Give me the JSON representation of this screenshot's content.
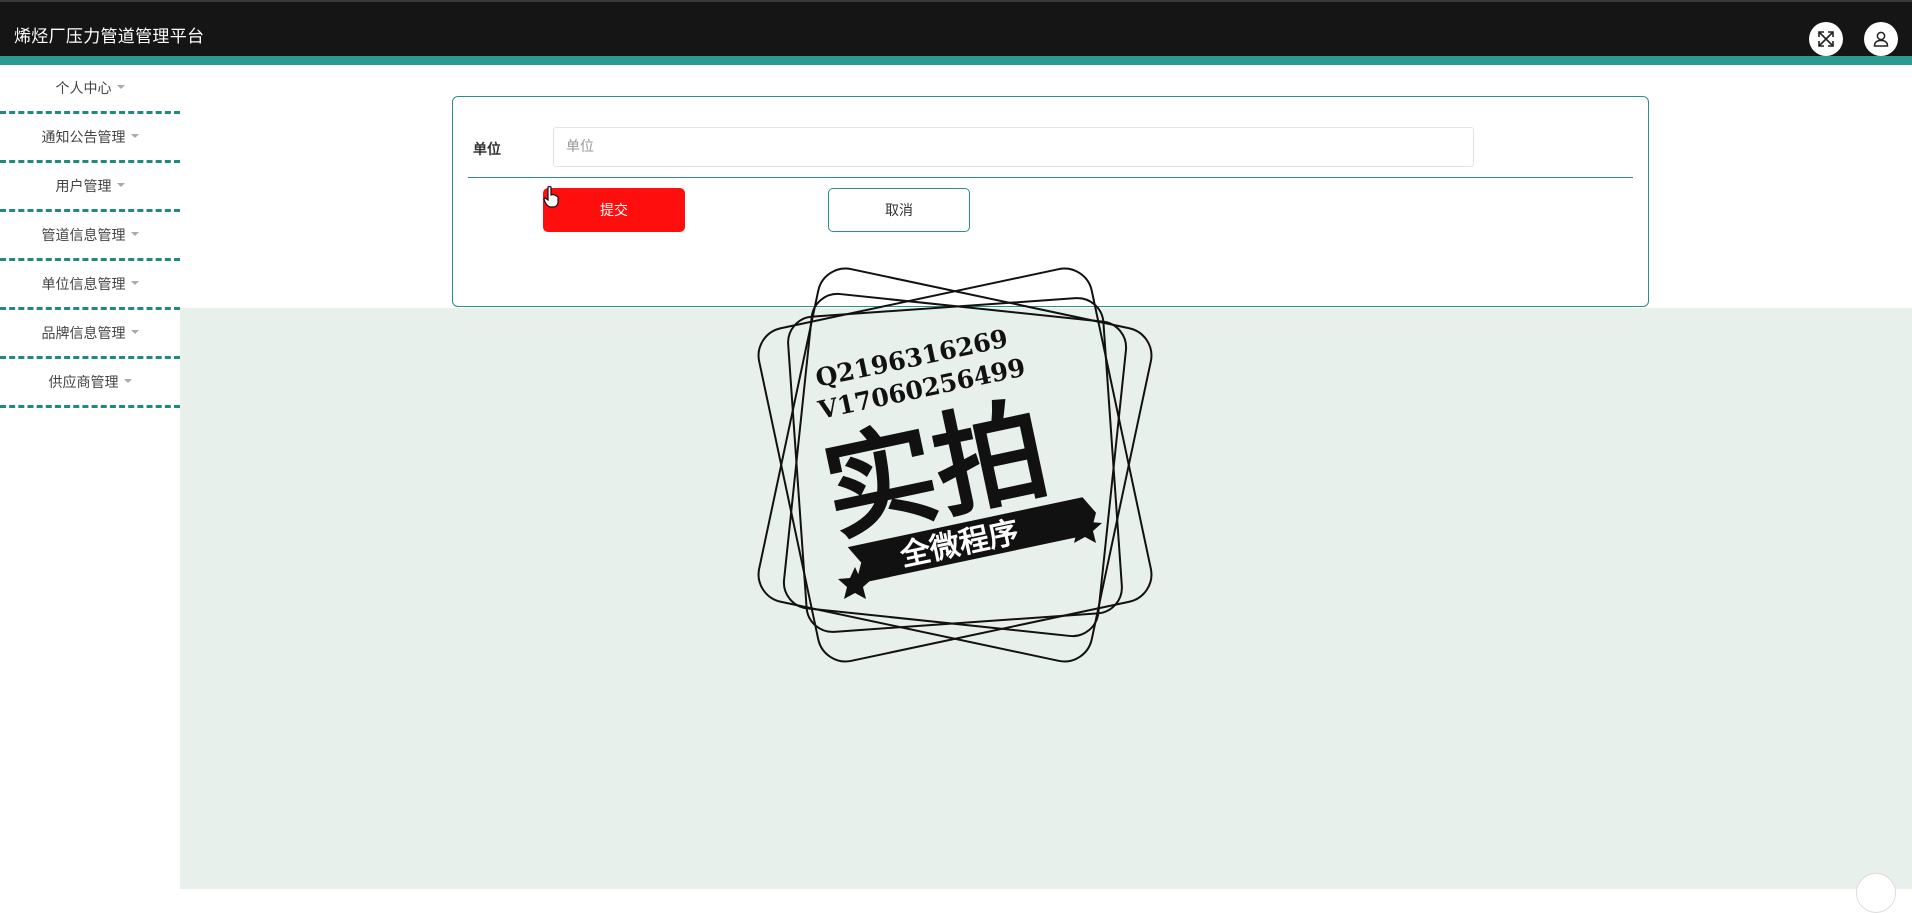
{
  "header": {
    "app_title": "烯烃厂压力管道管理平台"
  },
  "sidebar": {
    "items": [
      {
        "label": "个人中心"
      },
      {
        "label": "通知公告管理"
      },
      {
        "label": "用户管理"
      },
      {
        "label": "管道信息管理"
      },
      {
        "label": "单位信息管理"
      },
      {
        "label": "品牌信息管理"
      },
      {
        "label": "供应商管理"
      }
    ]
  },
  "form": {
    "unit_label": "单位",
    "unit_placeholder": "单位",
    "unit_value": "",
    "submit_label": "提交",
    "cancel_label": "取消"
  },
  "watermark": {
    "line1": "Q2196316269",
    "line2": "V17060256499",
    "main": "实拍",
    "banner": "全微程序"
  },
  "colors": {
    "topbar": "#151515",
    "accent": "#2b9b8f",
    "submit": "#ff0e0e",
    "content_bg": "#e8f0ec"
  }
}
